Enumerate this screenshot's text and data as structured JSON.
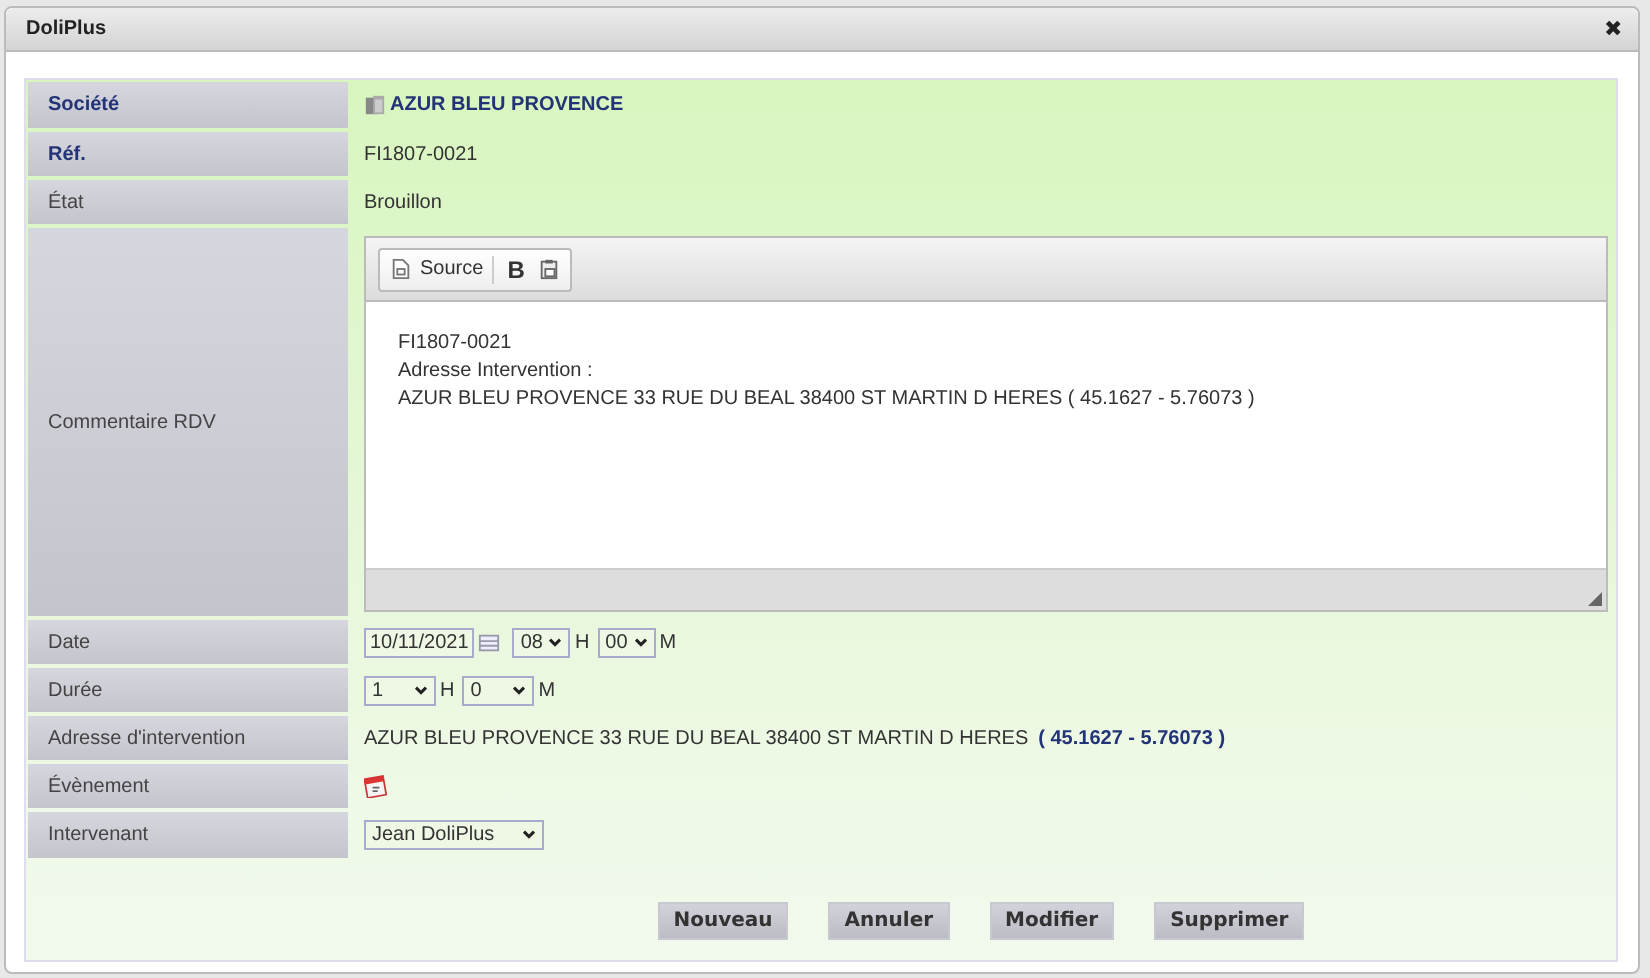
{
  "window": {
    "title": "DoliPlus",
    "close": "✖"
  },
  "fields": [
    {
      "kind": "link",
      "label": "Société",
      "required": true,
      "value": "AZUR BLEU PROVENCE"
    },
    {
      "kind": "text",
      "label": "Réf.",
      "required": true,
      "value": "FI1807-0021"
    },
    {
      "kind": "text",
      "label": "État",
      "required": false,
      "value": "Brouillon"
    },
    {
      "kind": "editor",
      "label": "Commentaire RDV",
      "required": false,
      "toolbar": {
        "source": "Source",
        "bold": "B"
      },
      "lines": [
        "FI1807-0021",
        "Adresse Intervention :",
        "AZUR BLEU PROVENCE 33 RUE DU BEAL 38400 ST MARTIN D HERES ( 45.1627 - 5.76073 )"
      ]
    },
    {
      "kind": "datetime",
      "label": "Date",
      "required": false,
      "date": "10/11/2021",
      "hour": "08",
      "hour_unit": "H",
      "minute": "00",
      "minute_unit": "M"
    },
    {
      "kind": "duration",
      "label": "Durée",
      "required": false,
      "hour": "1",
      "hour_unit": "H",
      "minute": "0",
      "minute_unit": "M"
    },
    {
      "kind": "address",
      "label": "Adresse d'intervention",
      "required": false,
      "value": "AZUR BLEU PROVENCE 33 RUE DU BEAL 38400 ST MARTIN D HERES",
      "coords": "( 45.1627 - 5.76073 )"
    },
    {
      "kind": "event",
      "label": "Évènement",
      "required": false
    },
    {
      "kind": "select",
      "label": "Intervenant",
      "required": false,
      "value": "Jean DoliPlus"
    }
  ],
  "buttons": [
    "Nouveau",
    "Annuler",
    "Modifier",
    "Supprimer"
  ]
}
